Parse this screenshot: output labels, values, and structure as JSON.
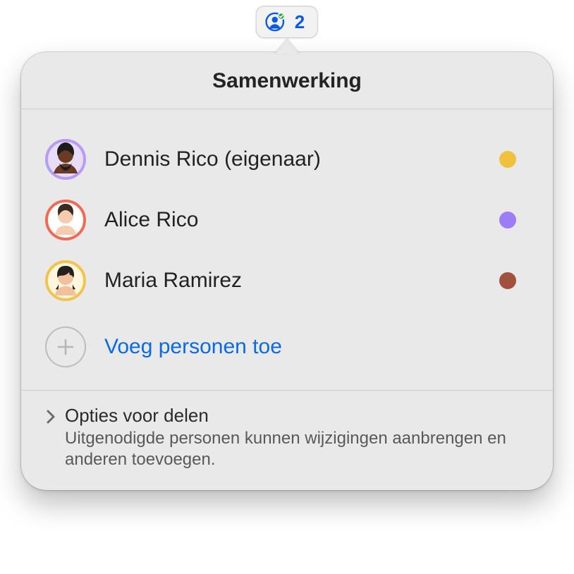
{
  "toolbar": {
    "collab_count": "2",
    "accent_color": "#0a5be0"
  },
  "popover": {
    "title": "Samenwerking",
    "participants": [
      {
        "name": "Dennis Rico (eigenaar)",
        "avatar_ring": "#b69cf2",
        "avatar_skin": "#6a3b24",
        "avatar_bg": "#e8ddf7",
        "dot_color": "#efc23c"
      },
      {
        "name": "Alice Rico",
        "avatar_ring": "#f06a56",
        "avatar_skin": "#f4cdb0",
        "avatar_bg": "#ffffff",
        "dot_color": "#9d7cf4"
      },
      {
        "name": "Maria Ramirez",
        "avatar_ring": "#f2c44e",
        "avatar_skin": "#f2c09a",
        "avatar_bg": "#fff6dd",
        "dot_color": "#a2513d"
      }
    ],
    "add_label": "Voeg personen toe",
    "footer_title": "Opties voor delen",
    "footer_sub": "Uitgenodigde personen kunnen wijzigingen aanbrengen en anderen toevoegen."
  }
}
